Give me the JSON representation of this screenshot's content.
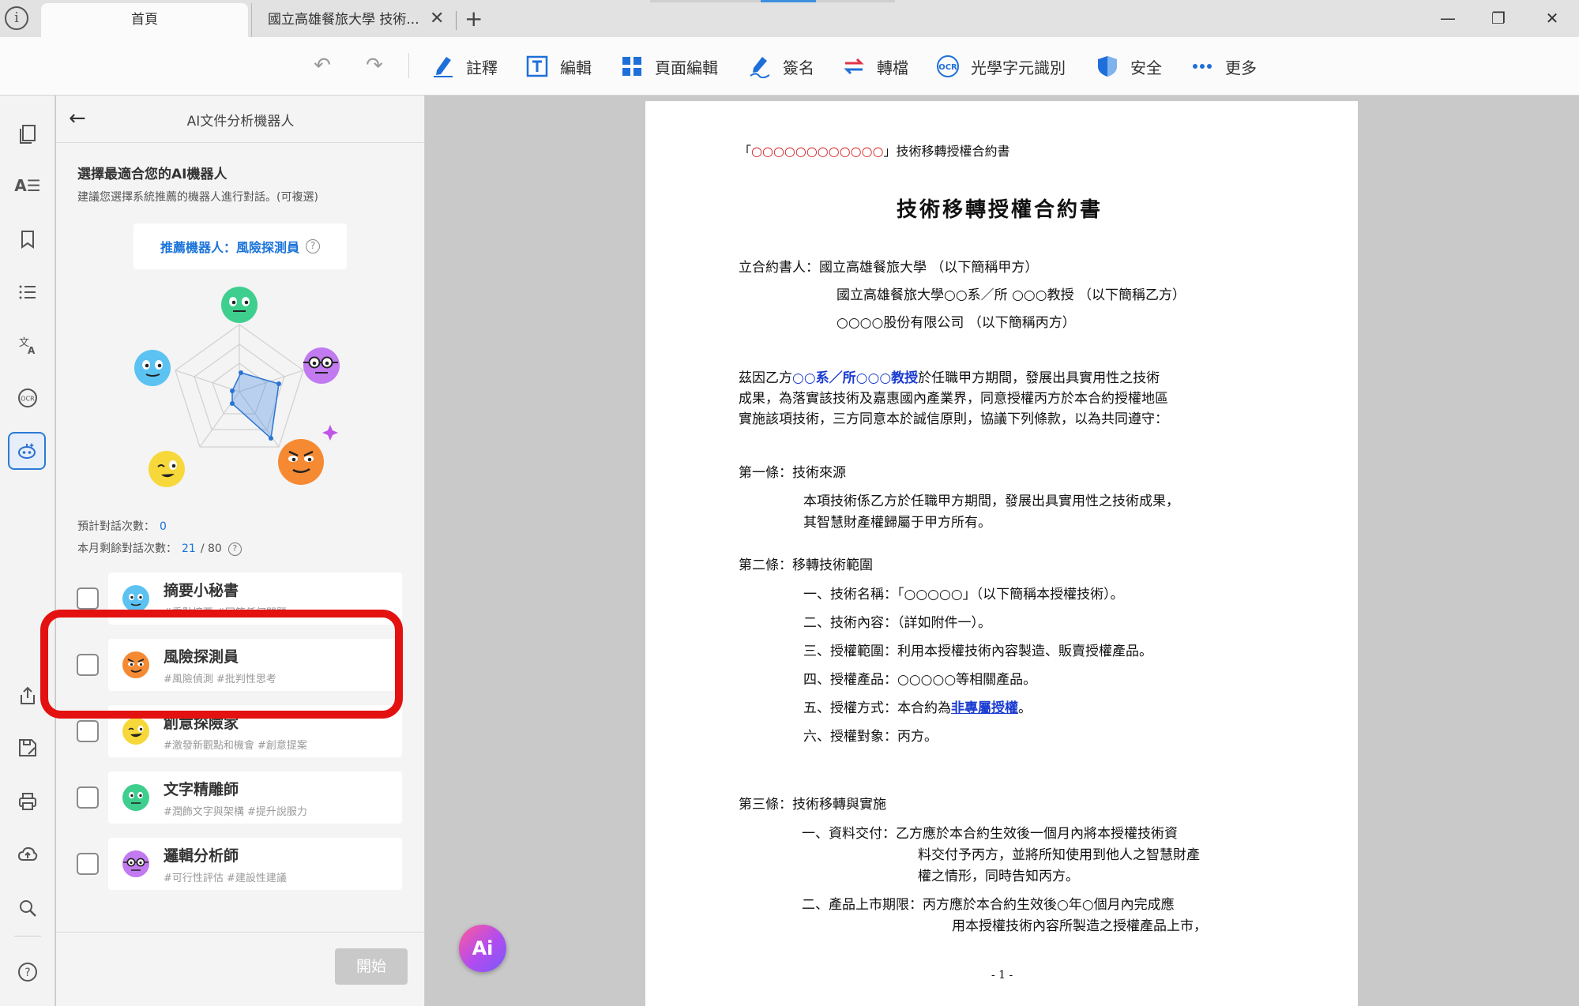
{
  "tabs": {
    "home": "首頁",
    "document": "國立高雄餐旅大學 技術..."
  },
  "toolbar": {
    "annotate": "註釋",
    "edit": "編輯",
    "page_edit": "頁面編輯",
    "sign": "簽名",
    "convert": "轉檔",
    "ocr": "光學字元識別",
    "security": "安全",
    "more": "更多"
  },
  "panel": {
    "title": "AI文件分析機器人",
    "choose_title": "選擇最適合您的AI機器人",
    "choose_sub": "建議您選擇系統推薦的機器人進行對話。(可複選)",
    "recommended": "推薦機器人：風險探測員",
    "est_label": "預計對話次數：",
    "est_value": "0",
    "remain_label": "本月剩餘對話次數：",
    "remain_value": "21",
    "remain_total": "/ 80",
    "start": "開始",
    "bots": [
      {
        "name": "摘要小秘書",
        "tags": "#重點摘要 #回答任何問題",
        "color": "#5bc2f2"
      },
      {
        "name": "風險探測員",
        "tags": "#風險偵測 #批判性思考",
        "color": "#f58a33"
      },
      {
        "name": "創意探險家",
        "tags": "#激發新觀點和機會 #創意提案",
        "color": "#f7d83a"
      },
      {
        "name": "文字精雕師",
        "tags": "#潤飾文字與架構 #提升說服力",
        "color": "#3ecf8e"
      },
      {
        "name": "邏輯分析師",
        "tags": "#可行性評估 #建設性建議",
        "color": "#c27af0"
      }
    ]
  },
  "document": {
    "header_prefix": "「",
    "header_red": "○○○○○○○○○○○○",
    "header_suffix": "」技術移轉授權合約書",
    "title": "技術移轉授權合約書",
    "p1": "立合約書人：國立高雄餐旅大學 （以下簡稱甲方）",
    "p2": "國立高雄餐旅大學○○系／所 ○○○教授 （以下簡稱乙方）",
    "p3": "○○○○股份有限公司 （以下簡稱丙方）",
    "b1_pre": "茲因乙方",
    "b1_blue": "○○系／所○○○教授",
    "b1_post": "於任職甲方期間，發展出具實用性之技術",
    "b2": "成果，為落實該技術及嘉惠國內產業界，同意授權丙方於本合約授權地區",
    "b3": "實施該項技術，三方同意本於誠信原則，協議下列條款，以為共同遵守：",
    "a1_title": "第一條：技術來源",
    "a1_l1": "本項技術係乙方於任職甲方期間，發展出具實用性之技術成果，",
    "a1_l2": "其智慧財產權歸屬于甲方所有。",
    "a2_title": "第二條：移轉技術範圍",
    "a2_i1": "一、技術名稱：「○○○○○」（以下簡稱本授權技術）。",
    "a2_i2": "二、技術內容：（詳如附件一）。",
    "a2_i3": "三、授權範圍：利用本授權技術內容製造、販賣授權產品。",
    "a2_i4": "四、授權產品：○○○○○等相關產品。",
    "a2_i5_pre": "五、授權方式：本合約為",
    "a2_i5_link": "非專屬授權",
    "a2_i5_post": "。",
    "a2_i6": "六、授權對象：丙方。",
    "a3_title": "第三條：技術移轉與實施",
    "a3_i1_l1": "一、資料交付：乙方應於本合約生效後一個月內將本授權技術資",
    "a3_i1_l2": "料交付予丙方，並將所知使用到他人之智慧財產",
    "a3_i1_l3": "權之情形，同時告知丙方。",
    "a3_i2_l1": "二、產品上市期限：丙方應於本合約生效後○年○個月內完成應",
    "a3_i2_l2": "用本授權技術內容所製造之授權產品上市，",
    "page_no": "- 1 -"
  },
  "ai_button": "Ai"
}
